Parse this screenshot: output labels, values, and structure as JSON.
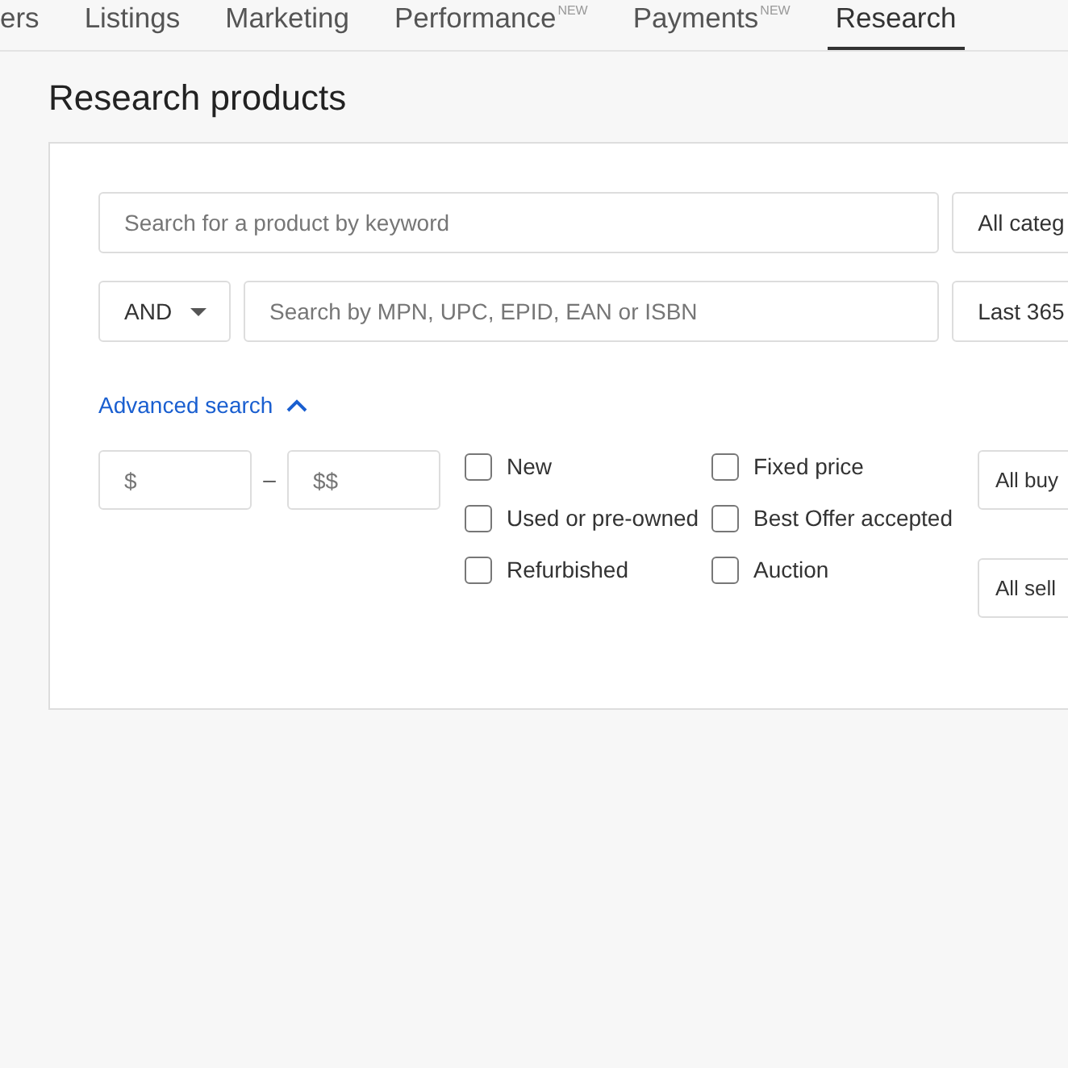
{
  "tabs": [
    {
      "label": "ers",
      "selected": false
    },
    {
      "label": "Listings",
      "selected": false
    },
    {
      "label": "Marketing",
      "selected": false
    },
    {
      "label": "Performance",
      "badge": "NEW",
      "selected": false
    },
    {
      "label": "Payments",
      "badge": "NEW",
      "selected": false
    },
    {
      "label": "Research",
      "selected": true
    }
  ],
  "page_title": "Research products",
  "keyword_search": {
    "placeholder": "Search for a product by keyword"
  },
  "category_dropdown": {
    "value": "All categ"
  },
  "operator_dropdown": {
    "value": "AND"
  },
  "id_search": {
    "placeholder": "Search by MPN, UPC, EPID, EAN or ISBN"
  },
  "date_range_dropdown": {
    "value": "Last 365"
  },
  "advanced_search": {
    "label": "Advanced search",
    "expanded": true
  },
  "price_min": {
    "placeholder": "$"
  },
  "price_separator": "–",
  "price_max": {
    "placeholder": "$$"
  },
  "condition_filters": [
    {
      "label": "New",
      "checked": false
    },
    {
      "label": "Used or pre-owned",
      "checked": false
    },
    {
      "label": "Refurbished",
      "checked": false
    }
  ],
  "format_filters": [
    {
      "label": "Fixed price",
      "checked": false
    },
    {
      "label": "Best Offer accepted",
      "checked": false
    },
    {
      "label": "Auction",
      "checked": false
    }
  ],
  "buyer_dropdown": {
    "value": "All buy"
  },
  "seller_dropdown": {
    "value": "All sell"
  }
}
